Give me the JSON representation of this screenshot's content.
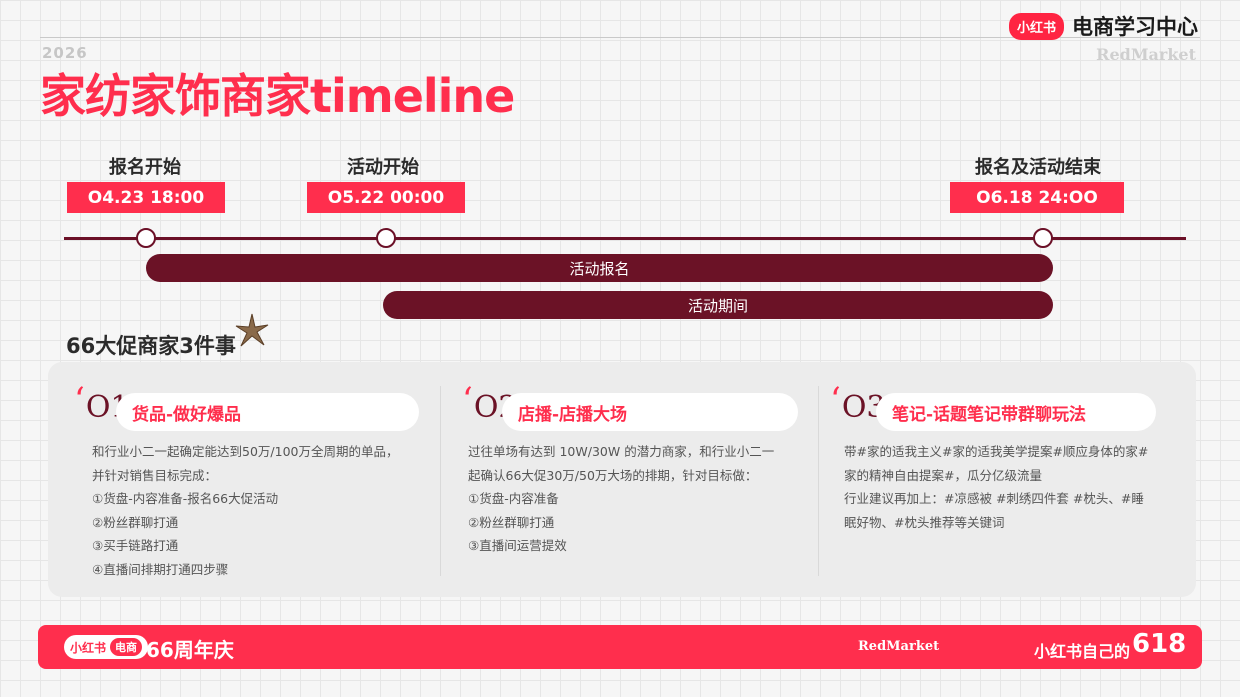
{
  "header": {
    "year": "2026",
    "title": "家纺家饰商家timeline",
    "brand_badge": "小红书",
    "brand_name": "电商学习中心",
    "brand_sub": "RedMarket"
  },
  "milestones": [
    {
      "label": "报名开始",
      "date": "O4.23 18:00"
    },
    {
      "label": "活动开始",
      "date": "O5.22 00:00"
    },
    {
      "label": "报名及活动结束",
      "date": "O6.18 24:OO"
    }
  ],
  "bars": [
    {
      "label": "活动报名"
    },
    {
      "label": "活动期间"
    }
  ],
  "section_title": "66大促商家3件事",
  "columns": [
    {
      "num": "O1",
      "title": "货品-做好爆品",
      "lines": [
        "和行业小二一起确定能达到50万/100万全周期的单品，",
        "并针对销售目标完成：",
        "①货盘-内容准备-报名66大促活动",
        "②粉丝群聊打通",
        "③买手链路打通",
        "④直播间排期打通四步骤"
      ]
    },
    {
      "num": "O2",
      "title": "店播-店播大场",
      "lines": [
        "过往单场有达到 10W/30W 的潜力商家，和行业小二一",
        "起确认66大促30万/50万大场的排期，针对目标做：",
        "①货盘-内容准备",
        "②粉丝群聊打通",
        "③直播间运营提效"
      ]
    },
    {
      "num": "O3",
      "title": "笔记-话题笔记带群聊玩法",
      "lines": [
        "带#家的适我主义#家的适我美学提案#顺应身体的家#",
        "家的精神自由提案#，瓜分亿级流量",
        "行业建议再加上：#凉感被 #刺绣四件套 #枕头、#睡",
        "眠好物、#枕头推荐等关键词"
      ]
    }
  ],
  "footer": {
    "badge_left": "小红书",
    "badge_right": "电商",
    "anniversary": "66周年庆",
    "redmarket": "RedMarket",
    "slogan": "小红书自己的",
    "number": "618"
  },
  "colors": {
    "accent": "#ff2e4d",
    "dark": "#6b1226"
  }
}
